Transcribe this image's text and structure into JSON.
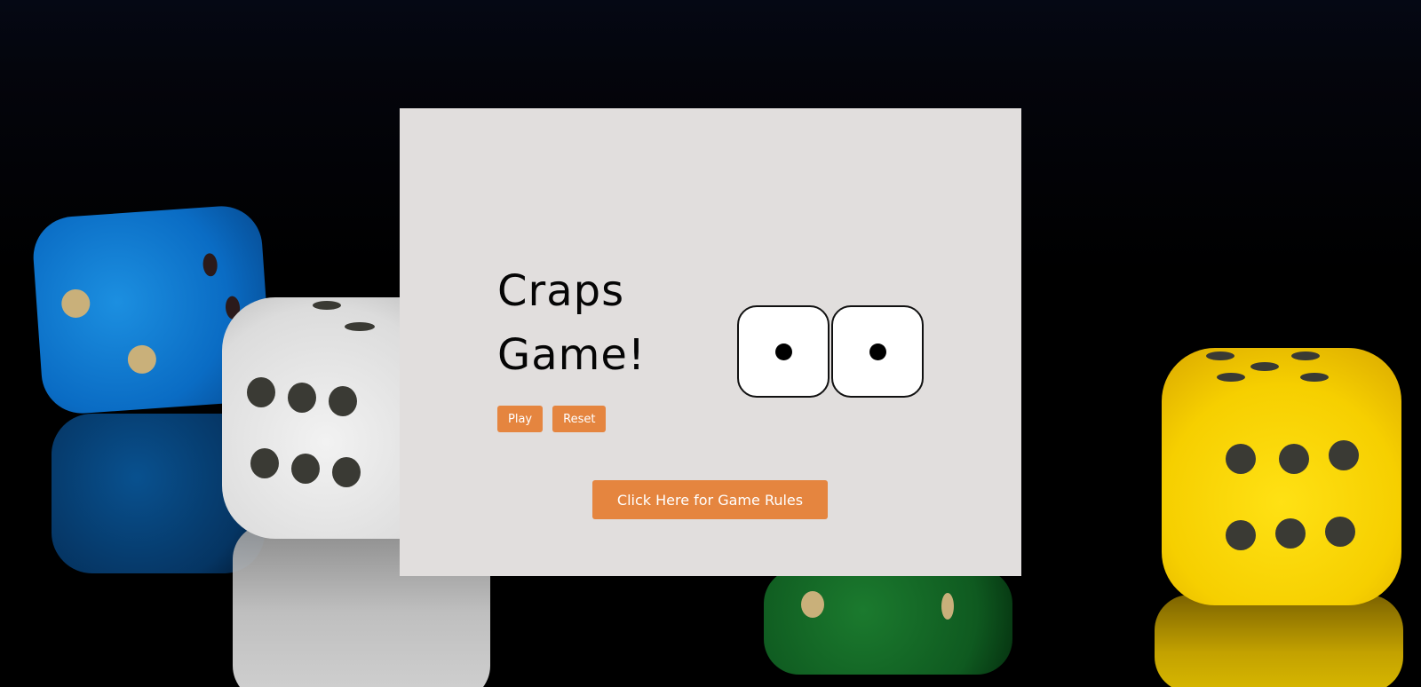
{
  "game": {
    "title_line1": "Craps",
    "title_line2": "Game!",
    "buttons": {
      "play": "Play",
      "reset": "Reset",
      "rules": "Click Here for Game Rules"
    },
    "dice": [
      {
        "value": 1
      },
      {
        "value": 1
      }
    ]
  },
  "colors": {
    "card_background": "#e1dedd",
    "button_accent": "#e5853f",
    "page_background": "#000000"
  }
}
